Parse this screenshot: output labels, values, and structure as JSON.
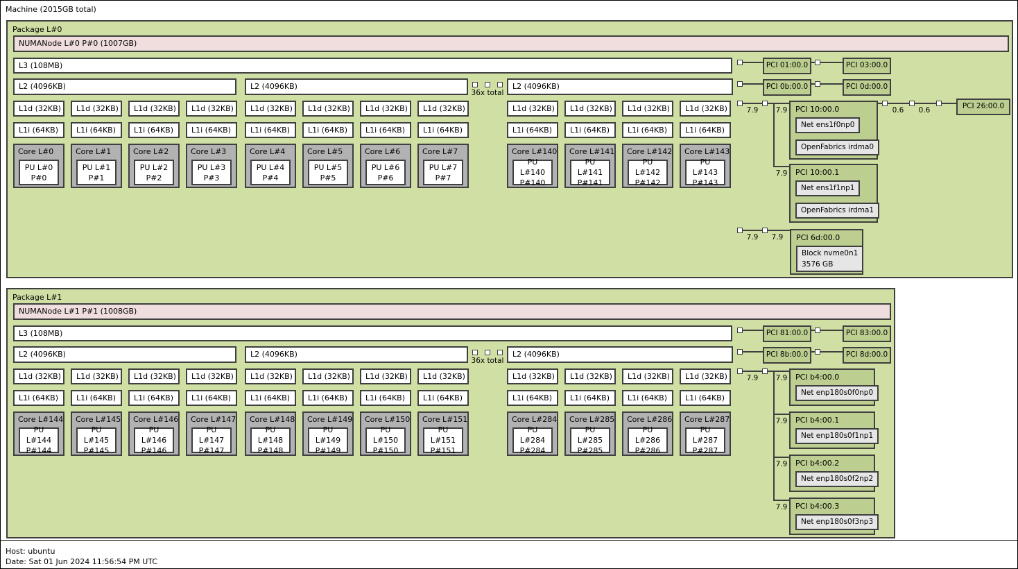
{
  "machine_label": "Machine (2015GB total)",
  "legend": {
    "host": "Host: ubuntu",
    "date": "Date: Sat 01 Jun 2024 11:56:54 PM UTC"
  },
  "colors": {
    "package_fill": "#d0e0a4",
    "numa_fill": "#f0dede",
    "cache_fill": "#ffffff",
    "core_fill": "#b2b2b2",
    "pu_fill": "#ffffff",
    "pci_fill": "#bccf90",
    "device_fill": "#e6e6e6",
    "border": "#3f3f3f"
  },
  "packages": [
    {
      "label": "Package L#0",
      "numa_label": "NUMANode L#0 P#0 (1007GB)",
      "l3_label": "L3 (108MB)",
      "l2_labels": [
        "L2 (4096KB)",
        "L2 (4096KB)",
        "L2 (4096KB)"
      ],
      "l1d_label": "L1d (32KB)",
      "l1i_label": "L1i (64KB)",
      "ellipsis_label": "36x total",
      "core_groups": [
        [
          {
            "core": "Core L#0",
            "pu": "PU L#0",
            "p": "P#0"
          },
          {
            "core": "Core L#1",
            "pu": "PU L#1",
            "p": "P#1"
          },
          {
            "core": "Core L#2",
            "pu": "PU L#2",
            "p": "P#2"
          },
          {
            "core": "Core L#3",
            "pu": "PU L#3",
            "p": "P#3"
          }
        ],
        [
          {
            "core": "Core L#4",
            "pu": "PU L#4",
            "p": "P#4"
          },
          {
            "core": "Core L#5",
            "pu": "PU L#5",
            "p": "P#5"
          },
          {
            "core": "Core L#6",
            "pu": "PU L#6",
            "p": "P#6"
          },
          {
            "core": "Core L#7",
            "pu": "PU L#7",
            "p": "P#7"
          }
        ],
        [
          {
            "core": "Core L#140",
            "pu": "PU L#140",
            "p": "P#140"
          },
          {
            "core": "Core L#141",
            "pu": "PU L#141",
            "p": "P#141"
          },
          {
            "core": "Core L#142",
            "pu": "PU L#142",
            "p": "P#142"
          },
          {
            "core": "Core L#143",
            "pu": "PU L#143",
            "p": "P#143"
          }
        ]
      ],
      "pci_pairs": [
        [
          "PCI 01:00.0",
          "PCI 03:00.0"
        ],
        [
          "PCI 0b:00.0",
          "PCI 0d:00.0"
        ]
      ],
      "pci_tree": {
        "root_link": "7.9",
        "children": [
          {
            "link": "7.9",
            "label": "PCI 10:00.0",
            "devices": [
              "Net ens1f0np0",
              "OpenFabrics irdma0"
            ]
          },
          {
            "link": "7.9",
            "label": "PCI 10:00.1",
            "devices": [
              "Net ens1f1np1",
              "OpenFabrics irdma1"
            ]
          }
        ]
      },
      "pci_chain": {
        "links": [
          "0.6",
          "0.6"
        ],
        "label": "PCI 26:00.0"
      },
      "pci_storage": {
        "links": [
          "7.9",
          "7.9"
        ],
        "label": "PCI 6d:00.0",
        "device_lines": [
          "Block nvme0n1",
          "3576 GB"
        ]
      }
    },
    {
      "label": "Package L#1",
      "numa_label": "NUMANode L#1 P#1 (1008GB)",
      "l3_label": "L3 (108MB)",
      "l2_labels": [
        "L2 (4096KB)",
        "L2 (4096KB)",
        "L2 (4096KB)"
      ],
      "l1d_label": "L1d (32KB)",
      "l1i_label": "L1i (64KB)",
      "ellipsis_label": "36x total",
      "core_groups": [
        [
          {
            "core": "Core L#144",
            "pu": "PU L#144",
            "p": "P#144"
          },
          {
            "core": "Core L#145",
            "pu": "PU L#145",
            "p": "P#145"
          },
          {
            "core": "Core L#146",
            "pu": "PU L#146",
            "p": "P#146"
          },
          {
            "core": "Core L#147",
            "pu": "PU L#147",
            "p": "P#147"
          }
        ],
        [
          {
            "core": "Core L#148",
            "pu": "PU L#148",
            "p": "P#148"
          },
          {
            "core": "Core L#149",
            "pu": "PU L#149",
            "p": "P#149"
          },
          {
            "core": "Core L#150",
            "pu": "PU L#150",
            "p": "P#150"
          },
          {
            "core": "Core L#151",
            "pu": "PU L#151",
            "p": "P#151"
          }
        ],
        [
          {
            "core": "Core L#284",
            "pu": "PU L#284",
            "p": "P#284"
          },
          {
            "core": "Core L#285",
            "pu": "PU L#285",
            "p": "P#285"
          },
          {
            "core": "Core L#286",
            "pu": "PU L#286",
            "p": "P#286"
          },
          {
            "core": "Core L#287",
            "pu": "PU L#287",
            "p": "P#287"
          }
        ]
      ],
      "pci_pairs": [
        [
          "PCI 81:00.0",
          "PCI 83:00.0"
        ],
        [
          "PCI 8b:00.0",
          "PCI 8d:00.0"
        ]
      ],
      "pci_tree": {
        "root_link": "7.9",
        "children": [
          {
            "link": "7.9",
            "label": "PCI b4:00.0",
            "devices": [
              "Net enp180s0f0np0"
            ]
          },
          {
            "link": "7.9",
            "label": "PCI b4:00.1",
            "devices": [
              "Net enp180s0f1np1"
            ]
          },
          {
            "link": "7.9",
            "label": "PCI b4:00.2",
            "devices": [
              "Net enp180s0f2np2"
            ]
          },
          {
            "link": "7.9",
            "label": "PCI b4:00.3",
            "devices": [
              "Net enp180s0f3np3"
            ]
          }
        ]
      }
    }
  ]
}
